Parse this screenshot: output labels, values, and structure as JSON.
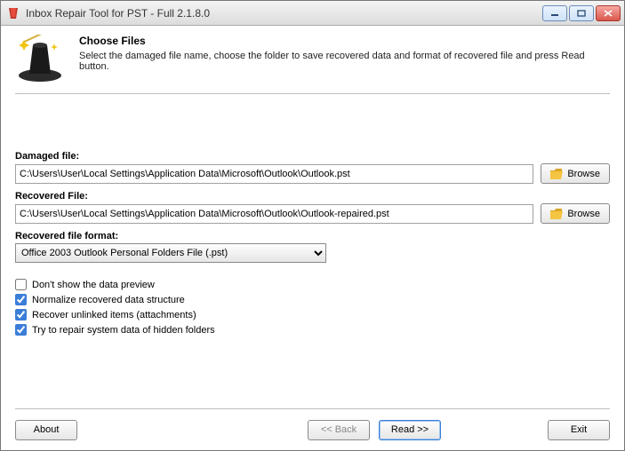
{
  "window": {
    "title": "Inbox Repair Tool for PST - Full 2.1.8.0"
  },
  "header": {
    "heading": "Choose Files",
    "description": "Select the damaged file name, choose the folder to save recovered data and format of recovered file and press Read button."
  },
  "fields": {
    "damaged": {
      "label": "Damaged file:",
      "value": "C:\\Users\\User\\Local Settings\\Application Data\\Microsoft\\Outlook\\Outlook.pst",
      "browse": "Browse"
    },
    "recovered": {
      "label": "Recovered File:",
      "value": "C:\\Users\\User\\Local Settings\\Application Data\\Microsoft\\Outlook\\Outlook-repaired.pst",
      "browse": "Browse"
    },
    "format": {
      "label": "Recovered file format:",
      "selected": "Office 2003 Outlook Personal Folders File (.pst)"
    }
  },
  "options": {
    "preview": {
      "label": "Don't show the data preview",
      "checked": false
    },
    "normalize": {
      "label": "Normalize recovered data structure",
      "checked": true
    },
    "unlinked": {
      "label": "Recover unlinked items (attachments)",
      "checked": true
    },
    "hidden": {
      "label": "Try to repair system data of hidden folders",
      "checked": true
    }
  },
  "footer": {
    "about": "About",
    "back": "<< Back",
    "read": "Read >>",
    "exit": "Exit"
  }
}
